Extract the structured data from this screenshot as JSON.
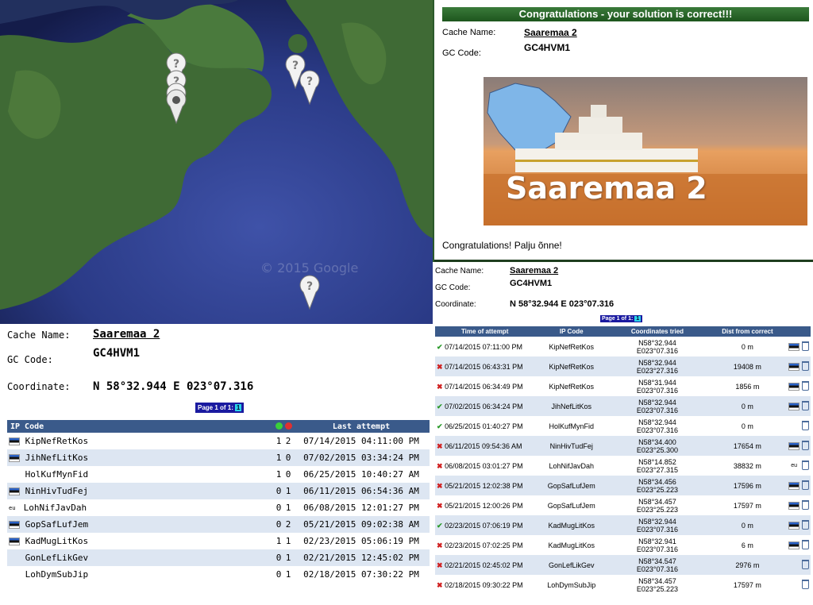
{
  "map": {
    "watermark": "© 2015 Google",
    "markers": [
      {
        "icon": "question-mark-icon"
      },
      {
        "icon": "question-mark-icon"
      },
      {
        "icon": "question-mark-icon"
      },
      {
        "icon": "user-location-icon"
      },
      {
        "icon": "question-mark-icon"
      },
      {
        "icon": "question-mark-icon"
      },
      {
        "icon": "question-mark-icon"
      }
    ]
  },
  "success": {
    "banner": "Congratulations - your solution is correct!!!",
    "cache_name_label": "Cache Name:",
    "cache_name": "Saaremaa 2",
    "gc_label": "GC Code:",
    "gc_code": "GC4HVM1",
    "image_title": "Saaremaa 2",
    "message": "Congratulations! Palju õnne!"
  },
  "left": {
    "cache_name_label": "Cache Name:",
    "cache_name": "Saaremaa 2",
    "gc_label": "GC Code:",
    "gc_code": "GC4HVM1",
    "coord_label": "Coordinate:",
    "coordinate": "N 58°32.944  E 023°07.316",
    "pager": "Page 1 of 1:",
    "page": "1",
    "columns": {
      "ip": "IP Code",
      "last": "Last attempt"
    },
    "rows": [
      {
        "flag": "ee",
        "ip": "KipNefRetKos",
        "ok": "1",
        "bad": "2",
        "last": "07/14/2015 04:11:00 PM"
      },
      {
        "flag": "ee",
        "ip": "JihNefLitKos",
        "ok": "1",
        "bad": "0",
        "last": "07/02/2015 03:34:24 PM"
      },
      {
        "flag": "",
        "ip": "HolKufMynFid",
        "ok": "1",
        "bad": "0",
        "last": "06/25/2015 10:40:27 AM"
      },
      {
        "flag": "ee",
        "ip": "NinHivTudFej",
        "ok": "0",
        "bad": "1",
        "last": "06/11/2015 06:54:36 AM"
      },
      {
        "flag": "eu",
        "ip": "LohNifJavDah",
        "ok": "0",
        "bad": "1",
        "last": "06/08/2015 12:01:27 PM"
      },
      {
        "flag": "ee",
        "ip": "GopSafLufJem",
        "ok": "0",
        "bad": "2",
        "last": "05/21/2015 09:02:38 AM"
      },
      {
        "flag": "ee",
        "ip": "KadMugLitKos",
        "ok": "1",
        "bad": "1",
        "last": "02/23/2015 05:06:19 PM"
      },
      {
        "flag": "",
        "ip": "GonLefLikGev",
        "ok": "0",
        "bad": "1",
        "last": "02/21/2015 12:45:02 PM"
      },
      {
        "flag": "",
        "ip": "LohDymSubJip",
        "ok": "0",
        "bad": "1",
        "last": "02/18/2015 07:30:22 PM"
      }
    ]
  },
  "right": {
    "cache_name_label": "Cache Name:",
    "cache_name": "Saaremaa 2",
    "gc_label": "GC Code:",
    "gc_code": "GC4HVM1",
    "coord_label": "Coordinate:",
    "coordinate": "N 58°32.944  E 023°07.316",
    "pager": "Page 1 of 1:",
    "page": "1",
    "columns": {
      "time": "Time of attempt",
      "ip": "IP Code",
      "coords": "Coordinates tried",
      "dist": "Dist from correct"
    },
    "rows": [
      {
        "ok": true,
        "time": "07/14/2015 07:11:00 PM",
        "ip": "KipNefRetKos",
        "n": "N58°32.944",
        "e": "E023°07.316",
        "dist": "0 m",
        "flag": "ee"
      },
      {
        "ok": false,
        "time": "07/14/2015 06:43:31 PM",
        "ip": "KipNefRetKos",
        "n": "N58°32.944",
        "e": "E023°27.316",
        "dist": "19408 m",
        "flag": "ee"
      },
      {
        "ok": false,
        "time": "07/14/2015 06:34:49 PM",
        "ip": "KipNefRetKos",
        "n": "N58°31.944",
        "e": "E023°07.316",
        "dist": "1856 m",
        "flag": "ee"
      },
      {
        "ok": true,
        "time": "07/02/2015 06:34:24 PM",
        "ip": "JihNefLitKos",
        "n": "N58°32.944",
        "e": "E023°07.316",
        "dist": "0 m",
        "flag": "ee"
      },
      {
        "ok": true,
        "time": "06/25/2015 01:40:27 PM",
        "ip": "HolKufMynFid",
        "n": "N58°32.944",
        "e": "E023°07.316",
        "dist": "0 m",
        "flag": ""
      },
      {
        "ok": false,
        "time": "06/11/2015 09:54:36 AM",
        "ip": "NinHivTudFej",
        "n": "N58°34.400",
        "e": "E023°25.300",
        "dist": "17654 m",
        "flag": "ee"
      },
      {
        "ok": false,
        "time": "06/08/2015 03:01:27 PM",
        "ip": "LohNifJavDah",
        "n": "N58°14.852",
        "e": "E023°27.315",
        "dist": "38832 m",
        "flag": "eu"
      },
      {
        "ok": false,
        "time": "05/21/2015 12:02:38 PM",
        "ip": "GopSafLufJem",
        "n": "N58°34.456",
        "e": "E023°25.223",
        "dist": "17596 m",
        "flag": "ee"
      },
      {
        "ok": false,
        "time": "05/21/2015 12:00:26 PM",
        "ip": "GopSafLufJem",
        "n": "N58°34.457",
        "e": "E023°25.223",
        "dist": "17597 m",
        "flag": "ee"
      },
      {
        "ok": true,
        "time": "02/23/2015 07:06:19 PM",
        "ip": "KadMugLitKos",
        "n": "N58°32.944",
        "e": "E023°07.316",
        "dist": "0 m",
        "flag": "ee"
      },
      {
        "ok": false,
        "time": "02/23/2015 07:02:25 PM",
        "ip": "KadMugLitKos",
        "n": "N58°32.941",
        "e": "E023°07.316",
        "dist": "6 m",
        "flag": "ee"
      },
      {
        "ok": false,
        "time": "02/21/2015 02:45:02 PM",
        "ip": "GonLefLikGev",
        "n": "N58°34.547",
        "e": "E023°07.316",
        "dist": "2976 m",
        "flag": ""
      },
      {
        "ok": false,
        "time": "02/18/2015 09:30:22 PM",
        "ip": "LohDymSubJip",
        "n": "N58°34.457",
        "e": "E023°25.223",
        "dist": "17597 m",
        "flag": ""
      }
    ]
  },
  "colors": {
    "header_bg": "#3a5a8a",
    "row_alt": "#dde6f2",
    "banner": "#2e6e2e",
    "ok": "#2a9a2a",
    "bad": "#d02020"
  }
}
